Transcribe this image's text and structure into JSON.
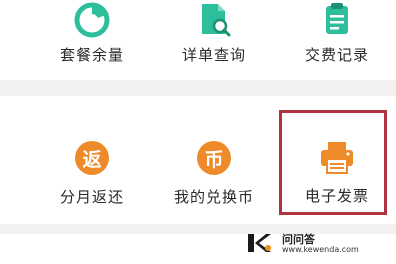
{
  "colors": {
    "teal": "#2dbf9b",
    "orange": "#ee8a2a",
    "highlight_border": "#b0343f"
  },
  "top_row": [
    {
      "label": "套餐余量",
      "icon": "pie-chart-icon"
    },
    {
      "label": "详单查询",
      "icon": "document-search-icon"
    },
    {
      "label": "交费记录",
      "icon": "receipt-icon"
    }
  ],
  "bottom_row": [
    {
      "label": "分月返还",
      "icon": "return-badge-icon",
      "glyph": "返"
    },
    {
      "label": "我的兑换币",
      "icon": "coin-badge-icon",
      "glyph": "币"
    },
    {
      "label": "电子发票",
      "icon": "printer-icon"
    }
  ],
  "watermark": {
    "title": "问问答",
    "url": "www.kewenda.com"
  }
}
